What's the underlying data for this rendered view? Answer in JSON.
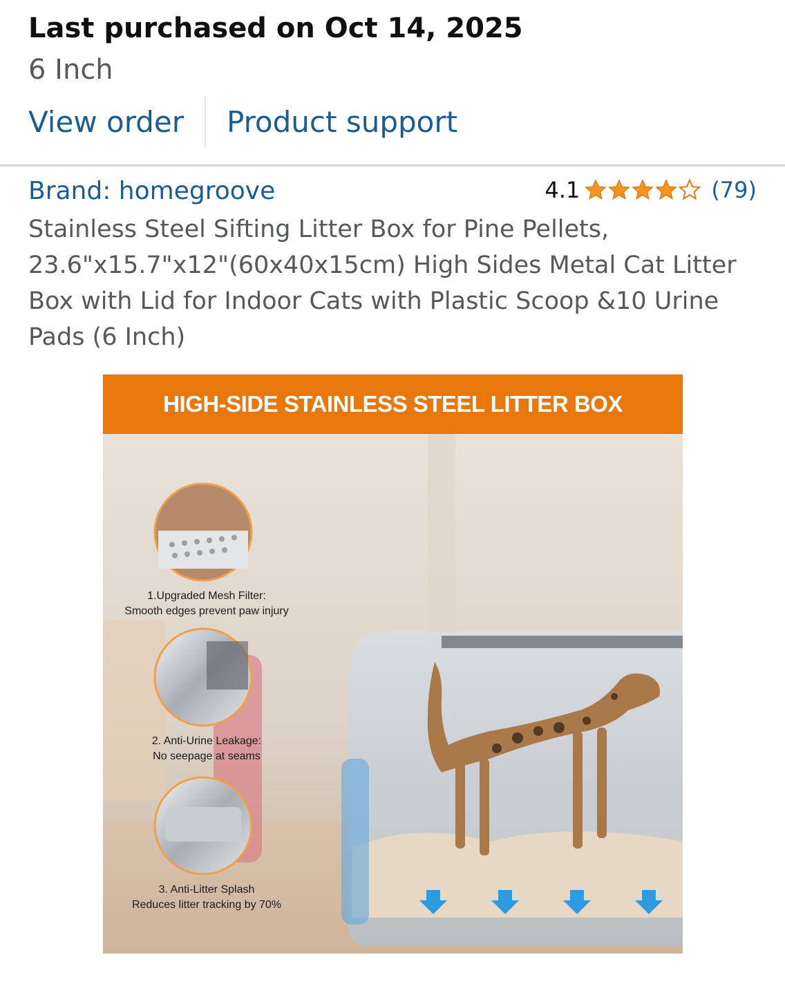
{
  "header": {
    "purchased_text": "Last purchased on Oct 14, 2025",
    "variant_text": "6 Inch"
  },
  "actions": {
    "view_order": "View order",
    "product_support": "Product support"
  },
  "product": {
    "brand": "Brand: homegroove",
    "rating_value": "4.1",
    "rating_stars": 4.1,
    "rating_count": "(79)",
    "title": "Stainless Steel Sifting Litter Box for Pine Pellets, 23.6\"x15.7\"x12\"(60x40x15cm) High Sides Metal Cat Litter Box with Lid for Indoor Cats with Plastic Scoop &10 Urine Pads (6 Inch)"
  },
  "image": {
    "banner": "HIGH-SIDE STAINLESS STEEL LITTER BOX",
    "features": [
      {
        "line1": "1.Upgraded Mesh Filter:",
        "line2": "Smooth edges prevent paw injury"
      },
      {
        "line1": "2. Anti-Urine Leakage:",
        "line2": "No seepage at seams"
      },
      {
        "line1": "3. Anti-Litter Splash",
        "line2": "Reduces litter tracking by 70%"
      }
    ]
  },
  "colors": {
    "link": "#1a5c96",
    "star": "#f7941d",
    "banner": "#e8780c"
  }
}
